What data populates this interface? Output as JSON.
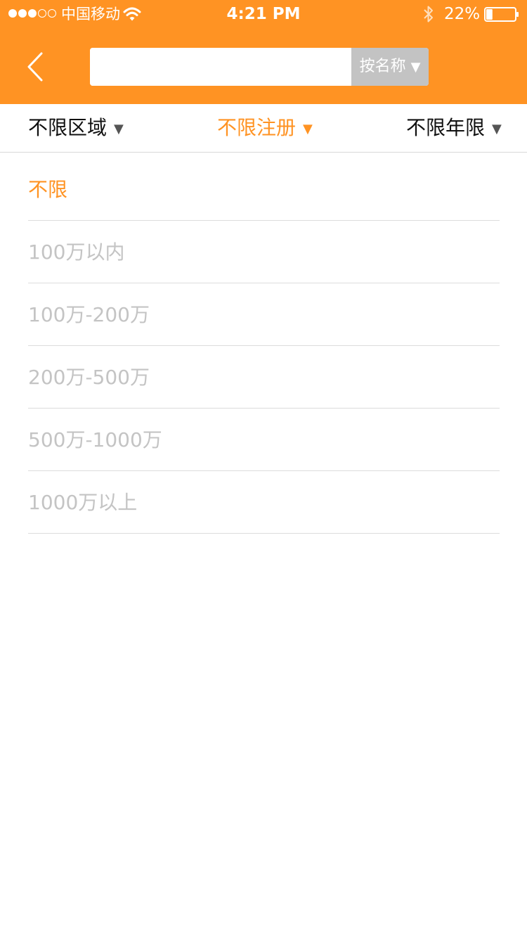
{
  "status_bar": {
    "carrier": "中国移动",
    "time": "4:21 PM",
    "battery_percent": "22%",
    "signal_bars_filled": 3,
    "signal_bars_total": 5,
    "battery_level": 0.22
  },
  "header": {
    "background_color": "#ff9323",
    "back_icon": "chevron-left-icon",
    "search": {
      "value": "",
      "placeholder": "",
      "type_selector_label": "按名称",
      "type_selector_caret": "▼"
    }
  },
  "filters": {
    "tabs": [
      {
        "label": "不限区域",
        "caret": "▼",
        "active": false
      },
      {
        "label": "不限注册",
        "caret": "▼",
        "active": true
      },
      {
        "label": "不限年限",
        "caret": "▼",
        "active": false
      }
    ]
  },
  "options": {
    "items": [
      {
        "label": "不限",
        "selected": true
      },
      {
        "label": "100万以内",
        "selected": false
      },
      {
        "label": "100万-200万",
        "selected": false
      },
      {
        "label": "200万-500万",
        "selected": false
      },
      {
        "label": "500万-1000万",
        "selected": false
      },
      {
        "label": "1000万以上",
        "selected": false
      }
    ]
  },
  "colors": {
    "accent": "#ff9323",
    "inactive_option": "#c4c4c4",
    "search_type_bg": "#c3c3c3"
  }
}
